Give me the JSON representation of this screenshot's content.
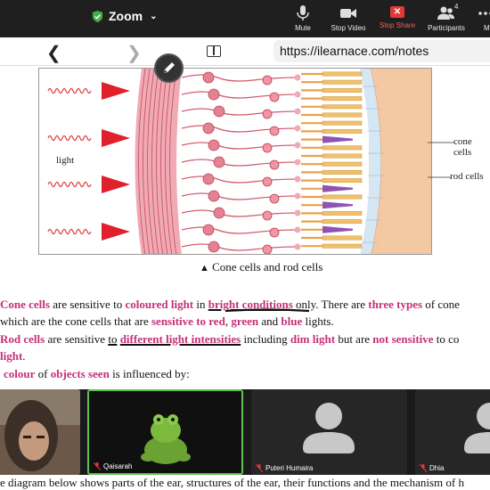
{
  "zoom": {
    "title": "Zoom",
    "buttons": [
      {
        "label": "Mute",
        "icon": "microphone-icon"
      },
      {
        "label": "Stop Video",
        "icon": "camera-icon"
      },
      {
        "label": "Stop Share",
        "icon": "stop-share-icon"
      },
      {
        "label": "Participants",
        "icon": "participants-icon",
        "count": "4"
      },
      {
        "label": "M",
        "icon": "more-icon"
      }
    ]
  },
  "browser": {
    "url": "https://ilearnace.com/notes"
  },
  "diagram": {
    "label_light": "light",
    "label_cone": "cone cells",
    "label_rod": "rod cells",
    "caption_marker": "▲",
    "caption": "Cone cells and rod cells"
  },
  "text": {
    "l1": [
      {
        "t": "Cone cells",
        "s": "m"
      },
      {
        "t": " are sensitive to ",
        "s": ""
      },
      {
        "t": "coloured light",
        "s": "m"
      },
      {
        "t": " in ",
        "s": ""
      },
      {
        "t": "bright conditions",
        "s": "mu"
      },
      {
        "t": " only. There are ",
        "s": ""
      },
      {
        "t": "three types",
        "s": "m"
      },
      {
        "t": " of cone",
        "s": ""
      }
    ],
    "l2": [
      {
        "t": "which are the cone cells that are ",
        "s": ""
      },
      {
        "t": "sensitive to red",
        "s": "m"
      },
      {
        "t": ", ",
        "s": ""
      },
      {
        "t": "green",
        "s": "m"
      },
      {
        "t": " and ",
        "s": ""
      },
      {
        "t": "blue",
        "s": "m"
      },
      {
        "t": " lights.",
        "s": ""
      }
    ],
    "l3": [
      {
        "t": "Rod cells",
        "s": "m"
      },
      {
        "t": " are sensitive ",
        "s": ""
      },
      {
        "t": "to",
        "s": "u"
      },
      {
        "t": " ",
        "s": ""
      },
      {
        "t": "different light intensities",
        "s": "mu"
      },
      {
        "t": " including ",
        "s": ""
      },
      {
        "t": "dim light",
        "s": "m"
      },
      {
        "t": " but are ",
        "s": ""
      },
      {
        "t": "not sensitive",
        "s": "m"
      },
      {
        "t": " to co",
        "s": ""
      }
    ],
    "l4": [
      {
        "t": "light",
        "s": "m"
      },
      {
        "t": ".",
        "s": ""
      }
    ],
    "l5": [
      {
        "t": "colour",
        "s": "m"
      },
      {
        "t": " of ",
        "s": ""
      },
      {
        "t": "objects seen",
        "s": "m"
      },
      {
        "t": " is influenced by:",
        "s": ""
      }
    ],
    "bottom": "e diagram below shows parts of the ear, structures of the ear, their functions and the mechanism of h"
  },
  "participants": [
    {
      "name": "",
      "type": "camera-self"
    },
    {
      "name": "Qaisarah",
      "type": "toy"
    },
    {
      "name": "Puteri Humaira",
      "type": "avatar"
    },
    {
      "name": "Dhia",
      "type": "avatar"
    }
  ]
}
